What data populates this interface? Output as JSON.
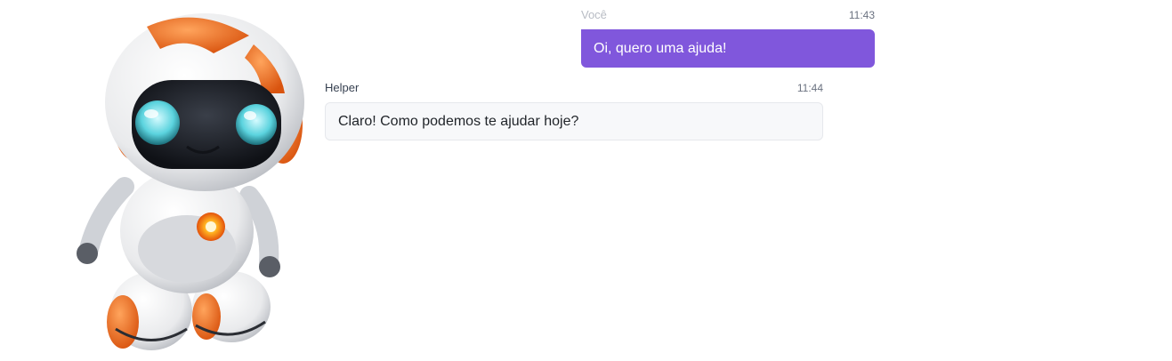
{
  "colors": {
    "user_bubble": "#8057dc",
    "helper_bubble": "#f7f8fa",
    "robot_accent": "#f0731e"
  },
  "mascot": {
    "icon": "robot-mascot-icon"
  },
  "messages": [
    {
      "sender": "Você",
      "time": "11:43",
      "text": "Oi, quero uma ajuda!"
    },
    {
      "sender": "Helper",
      "time": "11:44",
      "text": "Claro! Como podemos te ajudar hoje?"
    }
  ]
}
